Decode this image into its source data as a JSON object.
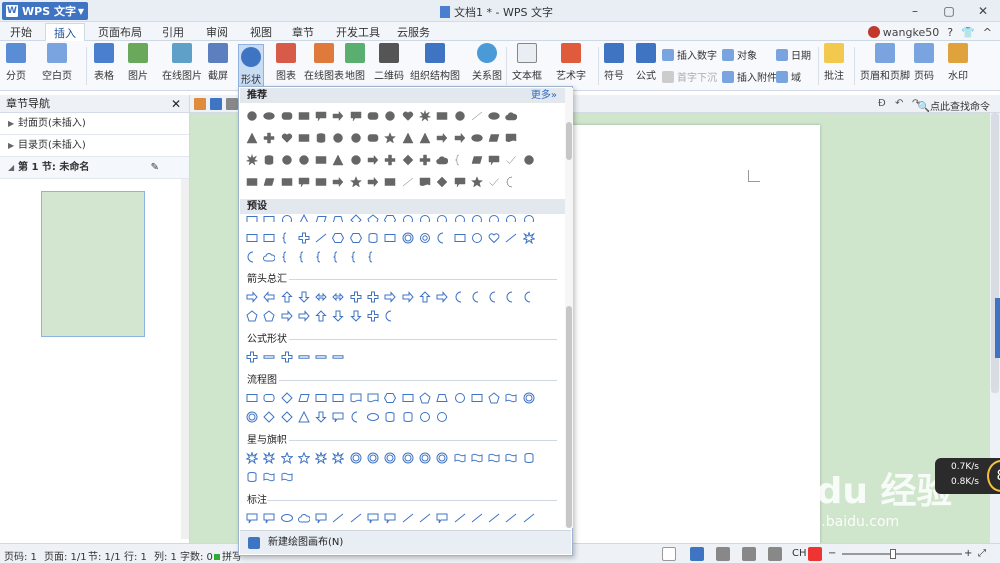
{
  "app": {
    "button": "WPS 文字",
    "title": "文档1 * - WPS 文字"
  },
  "menu": {
    "tabs": [
      "开始",
      "插入",
      "页面布局",
      "引用",
      "审阅",
      "视图",
      "章节",
      "开发工具",
      "云服务"
    ],
    "active": "插入"
  },
  "user": {
    "name": "wangke50"
  },
  "ribbon": {
    "items": [
      "分页",
      "空白页",
      "表格",
      "图片",
      "在线图片",
      "截屏",
      "形状",
      "图表",
      "在线图表",
      "地图",
      "二维码",
      "组织结构图",
      "关系图",
      "文本框",
      "艺术字",
      "符号",
      "公式",
      "批注",
      "页眉和页脚",
      "页码",
      "水印"
    ],
    "small": {
      "insert_number": "插入数字",
      "object": "对象",
      "date": "日期",
      "first_sink": "首字下沉",
      "attach": "插入附件",
      "field": "域"
    }
  },
  "nav": {
    "title": "章节导航",
    "items": [
      {
        "label": "封面页(未插入)"
      },
      {
        "label": "目录页(未插入)"
      },
      {
        "label": "第 1 节: 未命名"
      }
    ]
  },
  "find": {
    "label": "点此查找命令"
  },
  "shapes_panel": {
    "sections": [
      "推荐",
      "预设",
      "箭头总汇",
      "公式形状",
      "流程图",
      "星与旗帜",
      "标注"
    ],
    "more": "更多»",
    "footer": "新建绘图画布(N)"
  },
  "status": {
    "page_no": "页码: 1",
    "pages": "页面: 1/1",
    "section": "节: 1/1",
    "row": "行: 1",
    "col": "列: 1",
    "words": "字数: 0",
    "spell": "拼写",
    "ime": "CH"
  },
  "net": {
    "up": "0.7K/s",
    "down": "0.8K/s"
  },
  "watermark": {
    "logo": "Bai du 经验",
    "url": "jingyan.baidu.com"
  },
  "colors": {
    "accent": "#3f74c3",
    "canvas": "#cfe6cc"
  }
}
